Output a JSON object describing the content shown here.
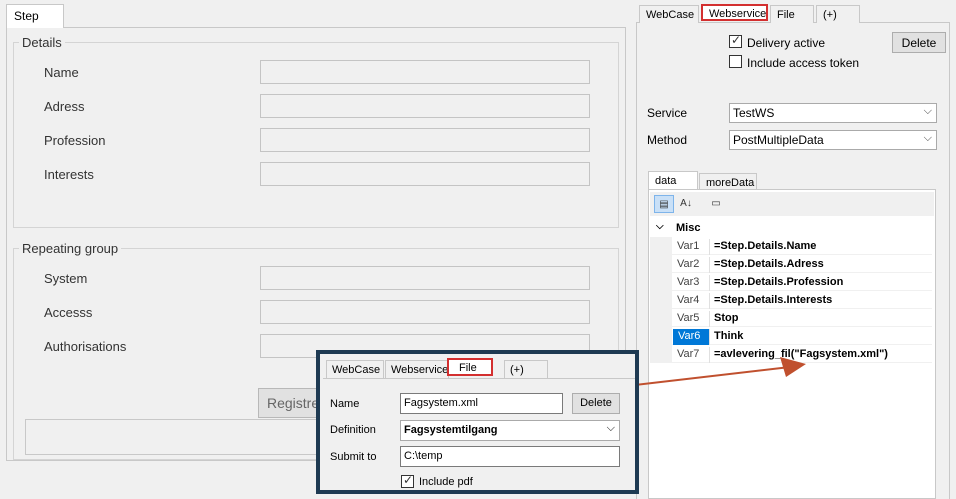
{
  "step": {
    "tab_label": "Step",
    "details": {
      "title": "Details",
      "fields": [
        "Name",
        "Adress",
        "Profession",
        "Interests"
      ]
    },
    "repeating_group": {
      "title": "Repeating group",
      "fields": [
        "System",
        "Accesss",
        "Authorisations"
      ]
    },
    "register_button": "Registre"
  },
  "webservice_panel": {
    "tabs": [
      "WebCase",
      "Webservice",
      "File",
      "(+)"
    ],
    "active_tab": "Webservice",
    "delivery_active_label": "Delivery active",
    "delivery_active_checked": true,
    "include_token_label": "Include access token",
    "include_token_checked": false,
    "delete_button": "Delete",
    "service_label": "Service",
    "service_value": "TestWS",
    "method_label": "Method",
    "method_value": "PostMultipleData",
    "data_tabs": [
      "data",
      "moreData"
    ],
    "property_grid": {
      "category": "Misc",
      "rows": [
        {
          "name": "Var1",
          "value": "=Step.Details.Name"
        },
        {
          "name": "Var2",
          "value": "=Step.Details.Adress"
        },
        {
          "name": "Var3",
          "value": "=Step.Details.Profession"
        },
        {
          "name": "Var4",
          "value": "=Step.Details.Interests"
        },
        {
          "name": "Var5",
          "value": "Stop"
        },
        {
          "name": "Var6",
          "value": "Think"
        },
        {
          "name": "Var7",
          "value": "=avlevering_fil(\"Fagsystem.xml\")"
        }
      ],
      "selected_row": "Var6"
    }
  },
  "file_popup": {
    "tabs": [
      "WebCase",
      "Webservice",
      "File",
      "(+)"
    ],
    "active_tab": "File",
    "name_label": "Name",
    "name_value": "Fagsystem.xml",
    "delete_button": "Delete",
    "definition_label": "Definition",
    "definition_value": "Fagsystemtilgang",
    "submit_label": "Submit to",
    "submit_value": "C:\\temp",
    "include_pdf_label": "Include pdf",
    "include_pdf_checked": true
  },
  "colors": {
    "highlight_red": "#d32f2f",
    "arrow": "#c0502e",
    "popup_border": "#1e3a52",
    "selection_blue": "#0078d7"
  }
}
